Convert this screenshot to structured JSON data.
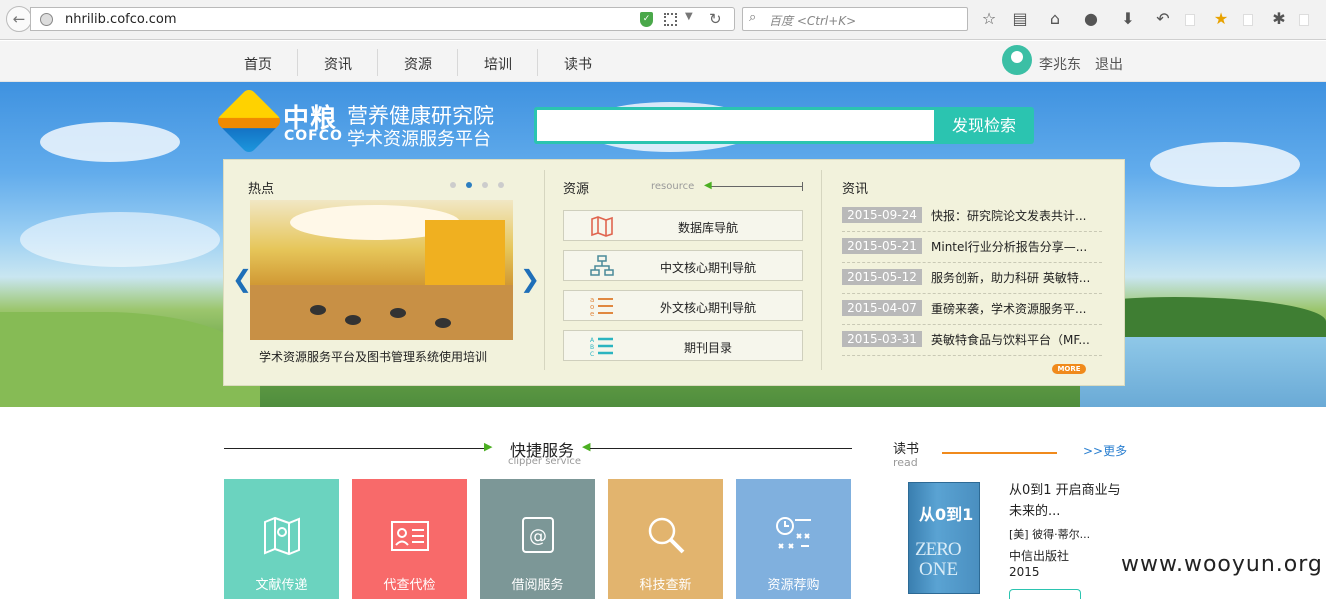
{
  "browser": {
    "url": "nhrilib.cofco.com",
    "search_placeholder": "百度 <Ctrl+K>"
  },
  "nav": {
    "items": [
      "首页",
      "资讯",
      "资源",
      "培训",
      "读书"
    ],
    "username": "李兆东",
    "logout": "退出"
  },
  "logo": {
    "cn": "中粮",
    "en": "COFCO",
    "line1": "营养健康研究院",
    "line2": "学术资源服务平台"
  },
  "search": {
    "value": "",
    "button": "发现检索"
  },
  "hot": {
    "title": "热点",
    "caption": "学术资源服务平台及图书管理系统使用培训",
    "active_slide": 2,
    "slide_count": 4
  },
  "resource": {
    "title": "资源",
    "subtitle": "resource",
    "items": [
      "数据库导航",
      "中文核心期刊导航",
      "外文核心期刊导航",
      "期刊目录"
    ]
  },
  "news": {
    "title": "资讯",
    "items": [
      {
        "date": "2015-09-24",
        "text": "快报：研究院论文发表共计..."
      },
      {
        "date": "2015-05-21",
        "text": "Mintel行业分析报告分享—..."
      },
      {
        "date": "2015-05-12",
        "text": "服务创新，助力科研 英敏特..."
      },
      {
        "date": "2015-04-07",
        "text": "重磅来袭，学术资源服务平..."
      },
      {
        "date": "2015-03-31",
        "text": "英敏特食品与饮料平台（MF..."
      }
    ],
    "more": "MORE"
  },
  "quick": {
    "title": "快捷服务",
    "subtitle": "clipper service",
    "tiles": [
      {
        "label": "文献传递",
        "color": "#6bd3bf",
        "icon": "map-icon"
      },
      {
        "label": "代查代检",
        "color": "#f86a6a",
        "icon": "id-card-icon"
      },
      {
        "label": "借阅服务",
        "color": "#7c9797",
        "icon": "email-book-icon"
      },
      {
        "label": "科技查新",
        "color": "#e2b46e",
        "icon": "magnifier-icon"
      },
      {
        "label": "资源荐购",
        "color": "#80b0de",
        "icon": "schedule-icon"
      }
    ]
  },
  "reading": {
    "title": "读书",
    "subtitle": "read",
    "more": ">>更多",
    "book": {
      "title": "从0到1 开启商业与未来的...",
      "author": "[美] 彼得·蒂尔...",
      "publisher": "中信出版社",
      "year": "2015",
      "cover_top": "从0到1",
      "cover_zero": "ZERO",
      "cover_one": "ONE"
    }
  },
  "watermark": "www.wooyun.org",
  "colors": {
    "accent": "#2bc4b0",
    "link": "#2a7fd0",
    "orange": "#f08a1c"
  }
}
